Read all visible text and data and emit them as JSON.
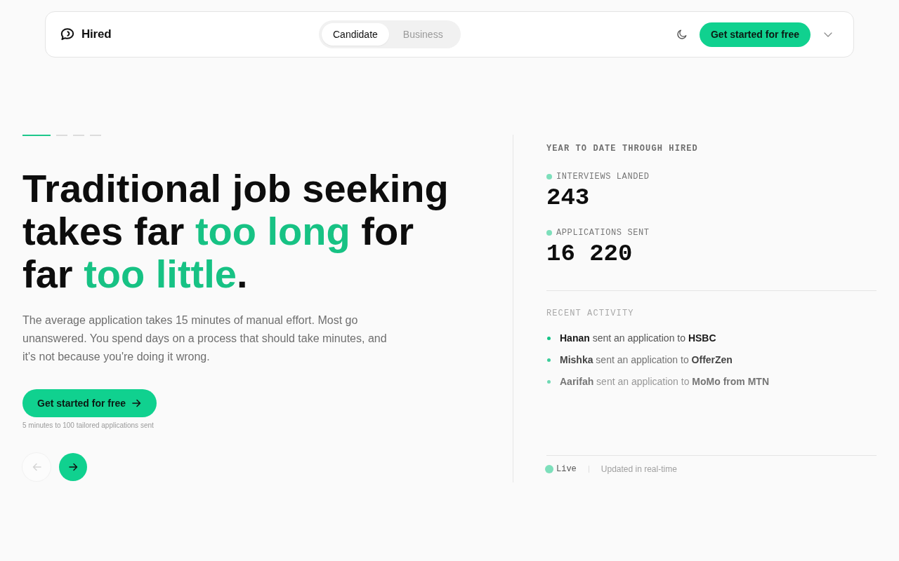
{
  "nav": {
    "brand": "Hired",
    "audience_tabs": [
      {
        "label": "Candidate",
        "selected": true
      },
      {
        "label": "Business",
        "selected": false
      }
    ],
    "cta": "Get started for free"
  },
  "hero": {
    "slides": [
      {
        "selected": true
      },
      {
        "selected": false
      },
      {
        "selected": false
      },
      {
        "selected": false
      }
    ],
    "headline": [
      {
        "text": "Traditional job seeking takes far ",
        "highlight": false
      },
      {
        "text": "too long",
        "highlight": true
      },
      {
        "text": " for far ",
        "highlight": false
      },
      {
        "text": "too little",
        "highlight": true
      },
      {
        "text": ".",
        "highlight": false
      }
    ],
    "body": "The average application takes 15 minutes of manual effort. Most go unanswered. You spend days on a process that should take minutes, and it's not because you're doing it wrong.",
    "cta": "Get started for free",
    "cta_note": "5 minutes to 100 tailored applications sent",
    "carousel_buttons": [
      {
        "kind": "prev",
        "disabled": true
      },
      {
        "kind": "next",
        "disabled": false
      }
    ]
  },
  "stats_panel": {
    "heading": "YEAR TO DATE THROUGH HIRED",
    "stats": [
      {
        "label": "INTERVIEWS LANDED",
        "value": "243"
      },
      {
        "label": "APPLICATIONS SENT",
        "value": "16 220"
      }
    ],
    "activity_heading": "RECENT ACTIVITY",
    "activity": [
      "**Hanan** sent an application to **HSBC**",
      "**Mishka** sent an application to **OfferZen**",
      "**Aarifah** sent an application to **MoMo from MTN**"
    ],
    "status": "Live",
    "status_note": "Updated in real-time"
  }
}
